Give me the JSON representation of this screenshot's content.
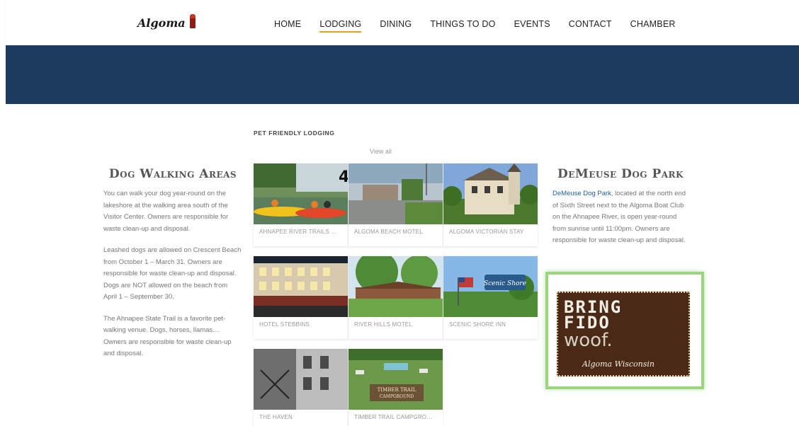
{
  "header": {
    "logo_text": "Algoma",
    "nav": [
      "HOME",
      "LODGING",
      "DINING",
      "THINGS TO DO",
      "EVENTS",
      "CONTACT",
      "CHAMBER"
    ],
    "active_nav": "LODGING"
  },
  "left": {
    "title": "Dog Walking Areas",
    "p1": "You can walk your dog year-round on the lakeshore at the walking area south of the Visitor Center. Owners are responsible for waste clean-up and disposal.",
    "p2": "Leashed dogs are allowed on Crescent Beach from October 1 – March 31. Owners are responsible for waste clean-up and disposal.  Dogs are NOT allowed on the beach from April 1 – September 30.",
    "p3": "The Ahnapee State Trail is a favorite pet-walking venue.  Dogs, horses, llamas… Owners are responsible for waste clean-up and disposal."
  },
  "center": {
    "title": "PET FRIENDLY LODGING",
    "view_all": "View all",
    "cards": [
      {
        "label": "AHNAPEE RIVER TRAILS …"
      },
      {
        "label": "ALGOMA BEACH MOTEL"
      },
      {
        "label": "ALGOMA VICTORIAN STAY"
      },
      {
        "label": "HOTEL STEBBINS"
      },
      {
        "label": "RIVER HILLS MOTEL"
      },
      {
        "label": "SCENIC SHORE INN"
      },
      {
        "label": "THE HAVEN"
      },
      {
        "label": "TIMBER TRAIL CAMPGRO…"
      }
    ],
    "img_texts": {
      "scenic_sign": "Scenic Shore",
      "timber_sign1": "TIMBER TRAIL",
      "timber_sign2": "CAMPGROUND"
    }
  },
  "right": {
    "title": "DeMeuse Dog Park",
    "link": "DeMeuse Dog Park",
    "text": ", located at the north end of Sixth Street next to the Algoma Boat Club on the Ahnapee River, is open year-round from sunrise until 11:00pm. Owners are responsible for waste clean-up and disposal.",
    "badge": {
      "line1": "BRING",
      "line2": "FIDO",
      "line3": "woof.",
      "line4": "Algoma Wisconsin"
    }
  },
  "colors": {
    "banner": "#1d3a5f",
    "accent": "#e2a21b",
    "link": "#1d5fa8",
    "badge_frame": "#9bd67e"
  }
}
